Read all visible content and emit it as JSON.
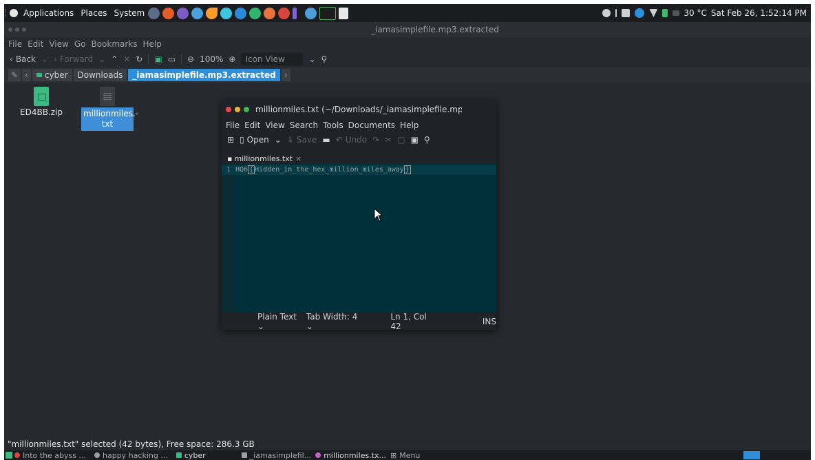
{
  "top_panel": {
    "menus": [
      "Applications",
      "Places",
      "System"
    ],
    "launcher_colors": [
      "#5b6d8a",
      "#e35d2b",
      "#7b5cc7",
      "#4aa0d8",
      "#ff9b2a",
      "#3ec6e0",
      "#2b8ad8",
      "#2fb56e",
      "#e8743b",
      "#d6463b",
      "#7b64d9",
      "#4a9eda",
      "#1c1c1c",
      "#e8e8e8"
    ],
    "weather": "30 °C",
    "datetime": "Sat Feb 26, 1:52:14 PM"
  },
  "file_manager": {
    "title": "_iamasimplefile.mp3.extracted",
    "menus": [
      "File",
      "Edit",
      "View",
      "Go",
      "Bookmarks",
      "Help"
    ],
    "toolbar": {
      "back": "Back",
      "forward": "Forward",
      "zoom": "100%",
      "view_mode": "Icon View"
    },
    "breadcrumbs": [
      "cyber",
      "Downloads",
      "_iamasimplefile.mp3.extracted"
    ],
    "files": [
      {
        "name": "ED4BB.zip",
        "icon": "zip-file-icon",
        "color": "#3dba82"
      },
      {
        "name": "millionmiles.-txt",
        "icon": "text-file-icon",
        "color": "#3b3f44"
      }
    ],
    "status": "\"millionmiles.txt\" selected (42 bytes), Free space: 286.3 GB"
  },
  "gedit": {
    "title": "millionmiles.txt (~/Downloads/_iamasimplefile.mp",
    "menus": [
      "File",
      "Edit",
      "View",
      "Search",
      "Tools",
      "Documents",
      "Help"
    ],
    "toolbar": {
      "open": "Open",
      "save": "Save",
      "undo": "Undo"
    },
    "tab_label": "millionmiles.txt",
    "line_number": "1",
    "code_prefix": "HQ6",
    "code_inner": "Hidden_in_the_hex_million_miles_away",
    "status": {
      "lang": "Plain Text",
      "tab_width": "Tab Width: 4",
      "position": "Ln 1, Col 42",
      "mode": "INS"
    }
  },
  "taskbar": {
    "tasks": [
      "Into the abyss ...",
      "happy hacking ...",
      "cyber",
      "_iamasimplefil...",
      "millionmiles.tx...",
      "Menu"
    ]
  }
}
